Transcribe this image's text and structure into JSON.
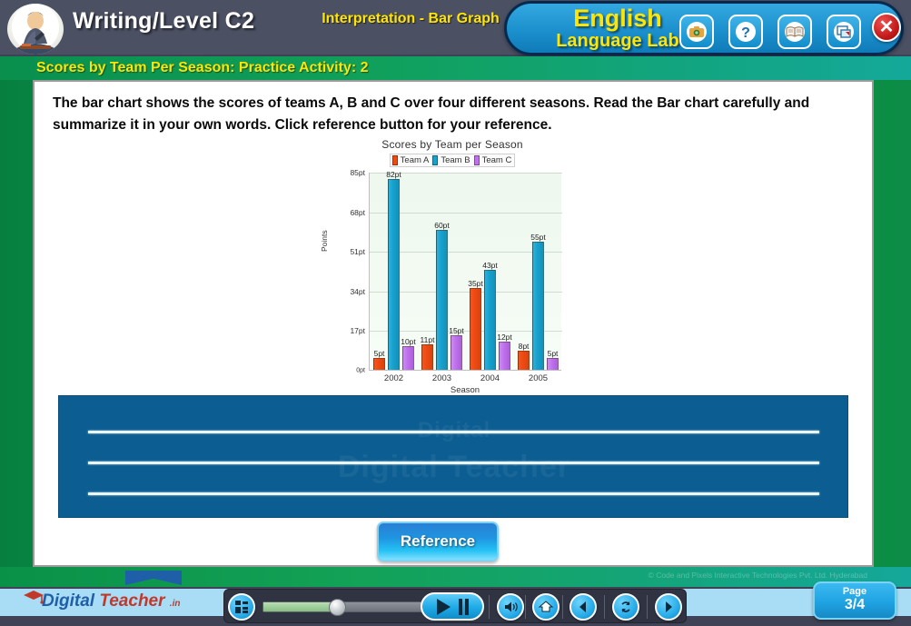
{
  "header": {
    "course_title": "Writing/Level C2",
    "topic_title": "Interpretation - Bar Graph",
    "brand_line1": "English",
    "brand_line2": "Language Lab",
    "avatar_name": "student-avatar",
    "buttons": [
      {
        "name": "camera-icon",
        "label": "Screenshot"
      },
      {
        "name": "help-icon",
        "label": "?"
      },
      {
        "name": "book-icon",
        "label": "Dictionary"
      },
      {
        "name": "print-icon",
        "label": "Print"
      }
    ],
    "close_label": "✕"
  },
  "subbar": {
    "text": "Scores by Team Per Season: Practice Activity: 2"
  },
  "main": {
    "instructions": "The bar chart shows the scores of teams A, B and C over four different seasons. Read the Bar chart carefully and summarize it in your own words. Click reference button for your reference.",
    "answer_placeholder": "",
    "watermark_top": "Digital",
    "watermark_bottom": "Digital Teacher",
    "reference_label": "Reference"
  },
  "chart_data": {
    "type": "bar",
    "title": "Scores by Team per Season",
    "xlabel": "Season",
    "ylabel": "Points",
    "categories": [
      "2002",
      "2003",
      "2004",
      "2005"
    ],
    "series": [
      {
        "name": "Team A",
        "color": "#ef4a12",
        "values": [
          5,
          11,
          35,
          8
        ],
        "labels": [
          "5pt",
          "11pt",
          "35pt",
          "8pt"
        ]
      },
      {
        "name": "Team B",
        "color": "#17a2ce",
        "values": [
          82,
          60,
          43,
          55
        ],
        "labels": [
          "82pt",
          "60pt",
          "43pt",
          "55pt"
        ]
      },
      {
        "name": "Team C",
        "color": "#bf72ec",
        "values": [
          10,
          15,
          12,
          5
        ],
        "labels": [
          "10pt",
          "15pt",
          "12pt",
          "5pt"
        ]
      }
    ],
    "ylim": [
      0,
      85
    ],
    "yticks": [
      0,
      17,
      34,
      51,
      68,
      85
    ],
    "ytick_labels": [
      "0pt",
      "17pt",
      "34pt",
      "51pt",
      "68pt",
      "85pt"
    ],
    "grid": true,
    "legend_position": "top"
  },
  "footer": {
    "copyright": "© Code and Pixels Interactive Technologies  Pvt. Ltd. Hyderabad",
    "logo_d": "Digital",
    "logo_t": " Teacher",
    "logo_in": ".in",
    "page_label": "Page",
    "page_value": "3/4",
    "controls": [
      {
        "name": "menu-icon",
        "label": "Menu"
      },
      {
        "name": "progress-slider",
        "label": "Progress"
      },
      {
        "name": "play-pause-button",
        "label": "Play / Pause"
      },
      {
        "name": "volume-icon",
        "label": "Volume"
      },
      {
        "name": "home-icon",
        "label": "Home"
      },
      {
        "name": "previous-icon",
        "label": "Previous"
      },
      {
        "name": "replay-icon",
        "label": "Replay"
      },
      {
        "name": "next-icon",
        "label": "Next"
      }
    ]
  }
}
